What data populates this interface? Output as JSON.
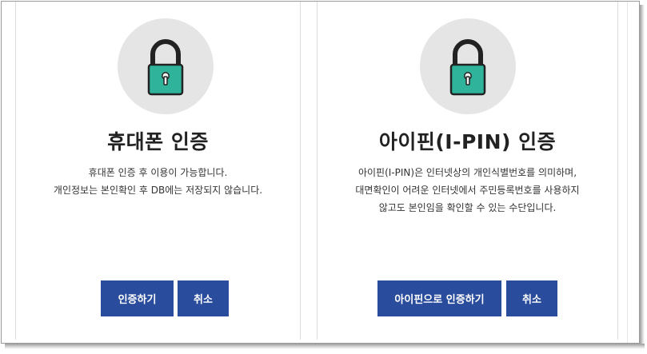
{
  "cards": [
    {
      "icon": "lock-icon",
      "title": "휴대폰 인증",
      "description": [
        "휴대폰 인증 후 이용이 가능합니다.",
        "개인정보는 본인확인 후 DB에는 저장되지 않습니다."
      ],
      "primary_label": "인증하기",
      "cancel_label": "취소"
    },
    {
      "icon": "lock-icon",
      "title": "아이핀(I-PIN) 인증",
      "description": [
        "아이핀(I-PIN)은 인터넷상의 개인식별번호를 의미하며,",
        "대면확인이 어려운 인터넷에서 주민등록번호를 사용하지",
        "않고도 본인임을 확인할 수 있는 수단입니다."
      ],
      "primary_label": "아이핀으로 인증하기",
      "cancel_label": "취소"
    }
  ],
  "colors": {
    "button": "#2a4c9c",
    "lock_body": "#2fb39a",
    "icon_circle": "#e5e5e5"
  }
}
